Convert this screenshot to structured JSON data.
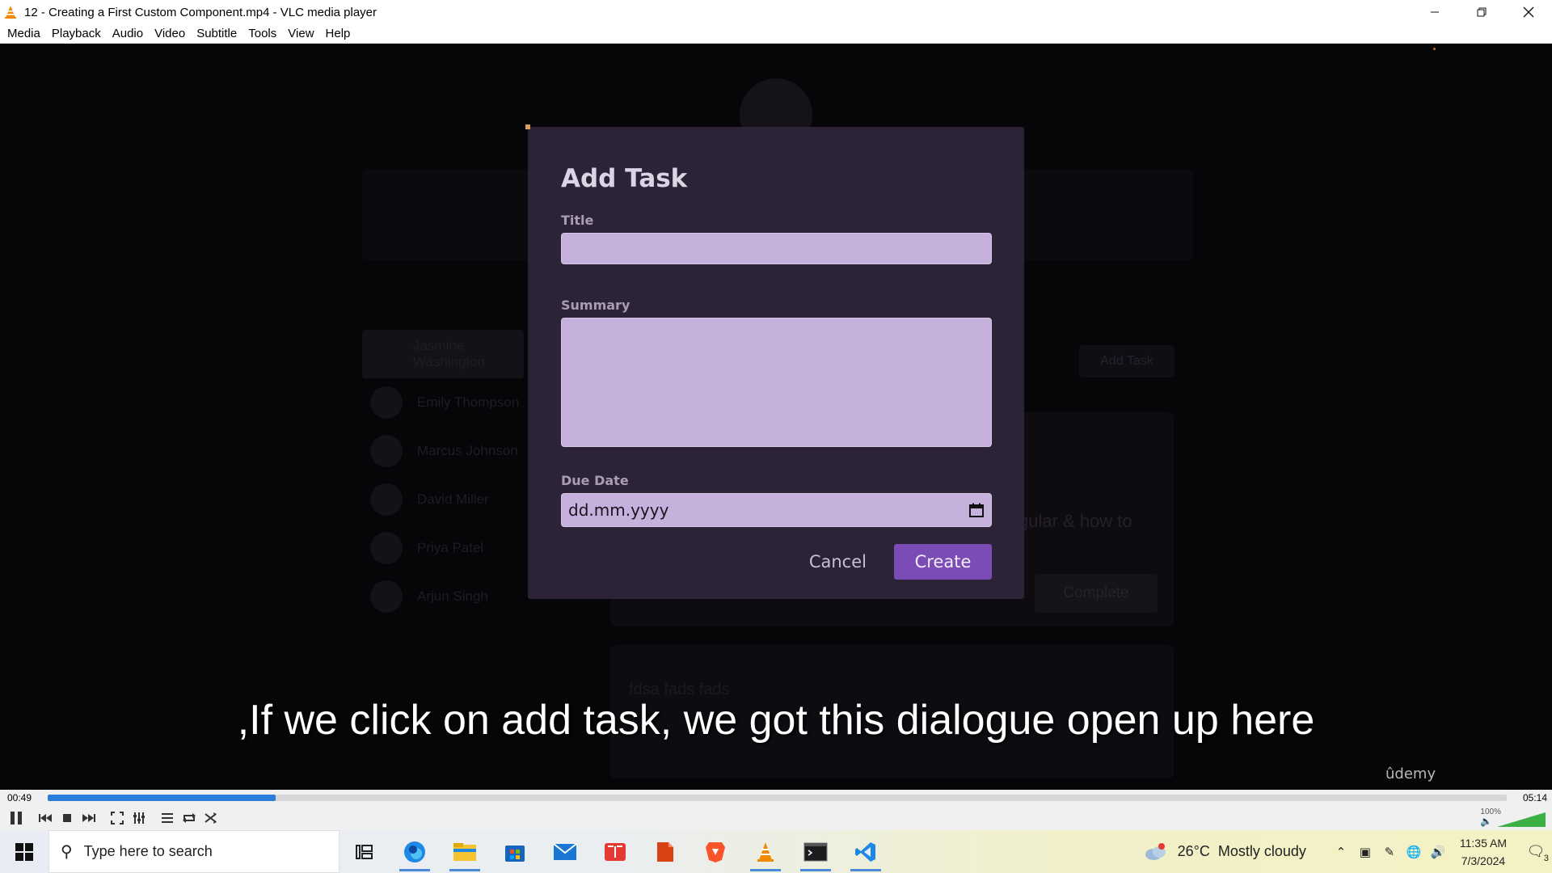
{
  "window": {
    "title": "12 - Creating a First Custom Component.mp4 - VLC media player"
  },
  "menu": [
    "Media",
    "Playback",
    "Audio",
    "Video",
    "Subtitle",
    "Tools",
    "View",
    "Help"
  ],
  "background_app": {
    "users": [
      "Jasmine Washington",
      "Emily Thompson",
      "Marcus Johnson",
      "David Miller",
      "Priya Patel",
      "Arjun Singh"
    ],
    "add_task_label": "Add Task",
    "card_text_fragment": "gular & how to",
    "complete_label": "Complete",
    "card2_text": "fdsa fads fads"
  },
  "dialog": {
    "heading": "Add Task",
    "title_label": "Title",
    "title_value": "",
    "summary_label": "Summary",
    "summary_value": "",
    "due_date_label": "Due Date",
    "due_date_value": "dd.mm.yyyy",
    "cancel_label": "Cancel",
    "create_label": "Create"
  },
  "subtitle": ",If we click on add task, we got this dialogue open up here",
  "watermark": "ûdemy",
  "player": {
    "elapsed": "00:49",
    "duration": "05:14",
    "progress_fraction": 0.156,
    "volume": "100%"
  },
  "taskbar": {
    "search_placeholder": "Type here to search",
    "weather_temp": "26°C",
    "weather_text": "Mostly cloudy",
    "weather_alert": "1",
    "time": "11:35 AM",
    "date": "7/3/2024",
    "notification_count": "3"
  },
  "colors": {
    "dialog_bg": "#2c2337",
    "input_bg": "#c6b0dc",
    "create_button": "#7b4bb6",
    "seek_fill": "#2a7dd8",
    "volume": "#3cb043"
  }
}
